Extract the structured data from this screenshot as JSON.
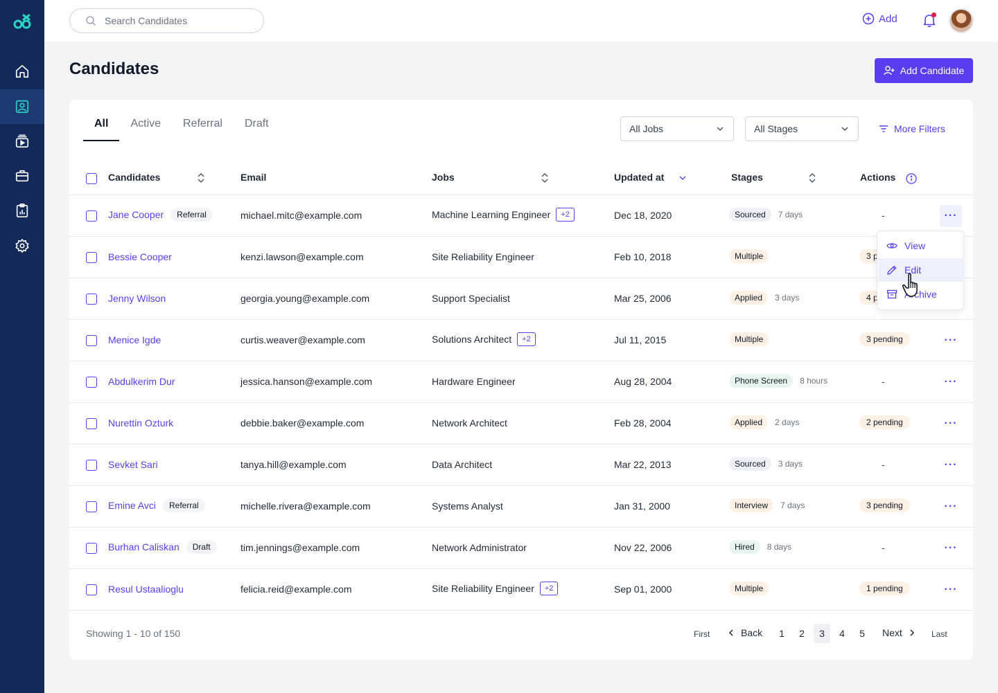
{
  "topbar": {
    "search_placeholder": "Search Candidates",
    "add_label": "Add"
  },
  "nav": {
    "items": [
      {
        "name": "home",
        "icon": "home-icon"
      },
      {
        "name": "candidates",
        "icon": "candidate-icon",
        "active": true
      },
      {
        "name": "videos",
        "icon": "video-stack-icon"
      },
      {
        "name": "jobs",
        "icon": "briefcase-icon"
      },
      {
        "name": "reports",
        "icon": "clipboard-chart-icon"
      },
      {
        "name": "settings",
        "icon": "gear-icon"
      }
    ]
  },
  "page": {
    "title": "Candidates",
    "add_candidate_label": "Add Candidate"
  },
  "tabs": [
    "All",
    "Active",
    "Referral",
    "Draft"
  ],
  "filters": {
    "jobs": "All Jobs",
    "stages": "All Stages",
    "more": "More Filters"
  },
  "columns": {
    "candidates": "Candidates",
    "email": "Email",
    "jobs": "Jobs",
    "updated": "Updated at",
    "stages": "Stages",
    "actions": "Actions"
  },
  "rows": [
    {
      "name": "Jane Cooper",
      "tag": "Referral",
      "email": "michael.mitc@example.com",
      "job": "Machine Learning Engineer",
      "extra": "+2",
      "updated": "Dec 18, 2020",
      "stage": "Sourced",
      "stage_class": "st-sourced",
      "ago": "7 days",
      "pending": "",
      "dash": "-"
    },
    {
      "name": "Bessie Cooper",
      "tag": "",
      "email": "kenzi.lawson@example.com",
      "job": "Site Reliability Engineer",
      "extra": "",
      "updated": "Feb 10, 2018",
      "stage": "Multiple",
      "stage_class": "st-multiple",
      "ago": "",
      "pending": "3 p",
      "dash": ""
    },
    {
      "name": "Jenny Wilson",
      "tag": "",
      "email": "georgia.young@example.com",
      "job": "Support Specialist",
      "extra": "",
      "updated": "Mar 25, 2006",
      "stage": "Applied",
      "stage_class": "st-applied",
      "ago": "3 days",
      "pending": "4 p",
      "dash": ""
    },
    {
      "name": "Menice Igde",
      "tag": "",
      "email": "curtis.weaver@example.com",
      "job": "Solutions Architect",
      "extra": "+2",
      "updated": "Jul 11, 2015",
      "stage": "Multiple",
      "stage_class": "st-multiple",
      "ago": "",
      "pending": "3 pending",
      "dash": ""
    },
    {
      "name": "Abdulkerim Dur",
      "tag": "",
      "email": "jessica.hanson@example.com",
      "job": "Hardware Engineer",
      "extra": "",
      "updated": "Aug 28, 2004",
      "stage": "Phone Screen",
      "stage_class": "st-phone",
      "ago": "8 hours",
      "pending": "",
      "dash": "-"
    },
    {
      "name": "Nurettin Ozturk",
      "tag": "",
      "email": "debbie.baker@example.com",
      "job": "Network Architect",
      "extra": "",
      "updated": "Feb 28, 2004",
      "stage": "Applied",
      "stage_class": "st-applied",
      "ago": "2 days",
      "pending": "2 pending",
      "dash": ""
    },
    {
      "name": "Sevket Sari",
      "tag": "",
      "email": "tanya.hill@example.com",
      "job": "Data Architect",
      "extra": "",
      "updated": "Mar 22, 2013",
      "stage": "Sourced",
      "stage_class": "st-sourced",
      "ago": "3 days",
      "pending": "",
      "dash": "-"
    },
    {
      "name": "Emine Avci",
      "tag": "Referral",
      "email": "michelle.rivera@example.com",
      "job": "Systems Analyst",
      "extra": "",
      "updated": "Jan 31, 2000",
      "stage": "Interview",
      "stage_class": "st-interview",
      "ago": "7 days",
      "pending": "3 pending",
      "dash": ""
    },
    {
      "name": "Burhan Caliskan",
      "tag": "Draft",
      "email": "tim.jennings@example.com",
      "job": "Network Administrator",
      "extra": "",
      "updated": "Nov 22, 2006",
      "stage": "Hired",
      "stage_class": "st-hired",
      "ago": "8 days",
      "pending": "",
      "dash": "-"
    },
    {
      "name": "Resul Ustaalioglu",
      "tag": "",
      "email": "felicia.reid@example.com",
      "job": "Site Reliability Engineer",
      "extra": "+2",
      "updated": "Sep 01, 2000",
      "stage": "Multiple",
      "stage_class": "st-multiple",
      "ago": "",
      "pending": "1 pending",
      "dash": ""
    }
  ],
  "menu": {
    "view": "View",
    "edit": "Edit",
    "archive": "Archive"
  },
  "footer": {
    "showing": "Showing 1 - 10 of 150",
    "first": "First",
    "back": "Back",
    "pages": [
      "1",
      "2",
      "3",
      "4",
      "5"
    ],
    "current_page": "3",
    "next": "Next",
    "last": "Last"
  },
  "colors": {
    "sidebar": "#12295a",
    "accent": "#5b3df0"
  }
}
